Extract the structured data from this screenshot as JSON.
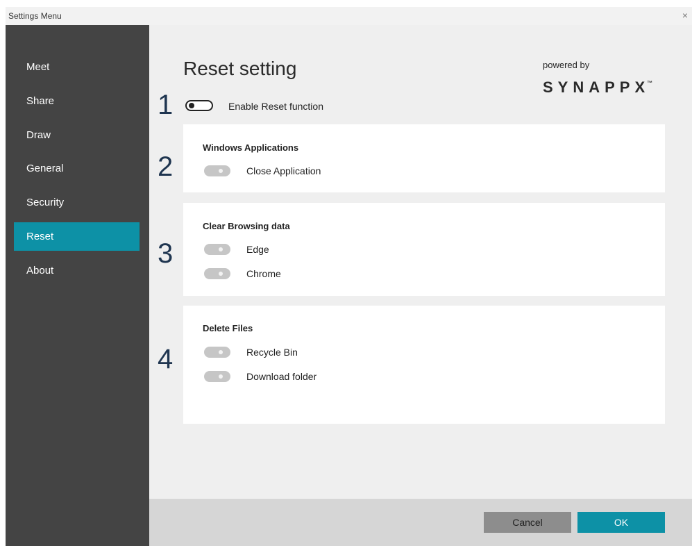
{
  "window": {
    "title": "Settings Menu",
    "close_glyph": "×"
  },
  "sidebar": {
    "items": [
      {
        "label": "Meet",
        "active": false
      },
      {
        "label": "Share",
        "active": false
      },
      {
        "label": "Draw",
        "active": false
      },
      {
        "label": "General",
        "active": false
      },
      {
        "label": "Security",
        "active": false
      },
      {
        "label": "Reset",
        "active": true
      },
      {
        "label": "About",
        "active": false
      }
    ]
  },
  "main": {
    "title": "Reset setting",
    "powered_by": "powered by",
    "brand": "SYNAPPX",
    "brand_tm": "™",
    "step_numbers": [
      "1",
      "2",
      "3",
      "4"
    ],
    "enable": {
      "label": "Enable Reset function",
      "on": false
    },
    "sections": [
      {
        "title": "Windows Applications",
        "options": [
          {
            "label": "Close Application",
            "enabled": false
          }
        ]
      },
      {
        "title": "Clear Browsing data",
        "options": [
          {
            "label": "Edge",
            "enabled": false
          },
          {
            "label": "Chrome",
            "enabled": false
          }
        ]
      },
      {
        "title": "Delete Files",
        "options": [
          {
            "label": "Recycle Bin",
            "enabled": false
          },
          {
            "label": "Download folder",
            "enabled": false
          }
        ]
      }
    ]
  },
  "footer": {
    "cancel_label": "Cancel",
    "ok_label": "OK"
  },
  "colors": {
    "accent": "#0d91a6",
    "sidebar_bg": "#444444",
    "footer_bg": "#d6d6d6",
    "number_color": "#1f3550"
  }
}
